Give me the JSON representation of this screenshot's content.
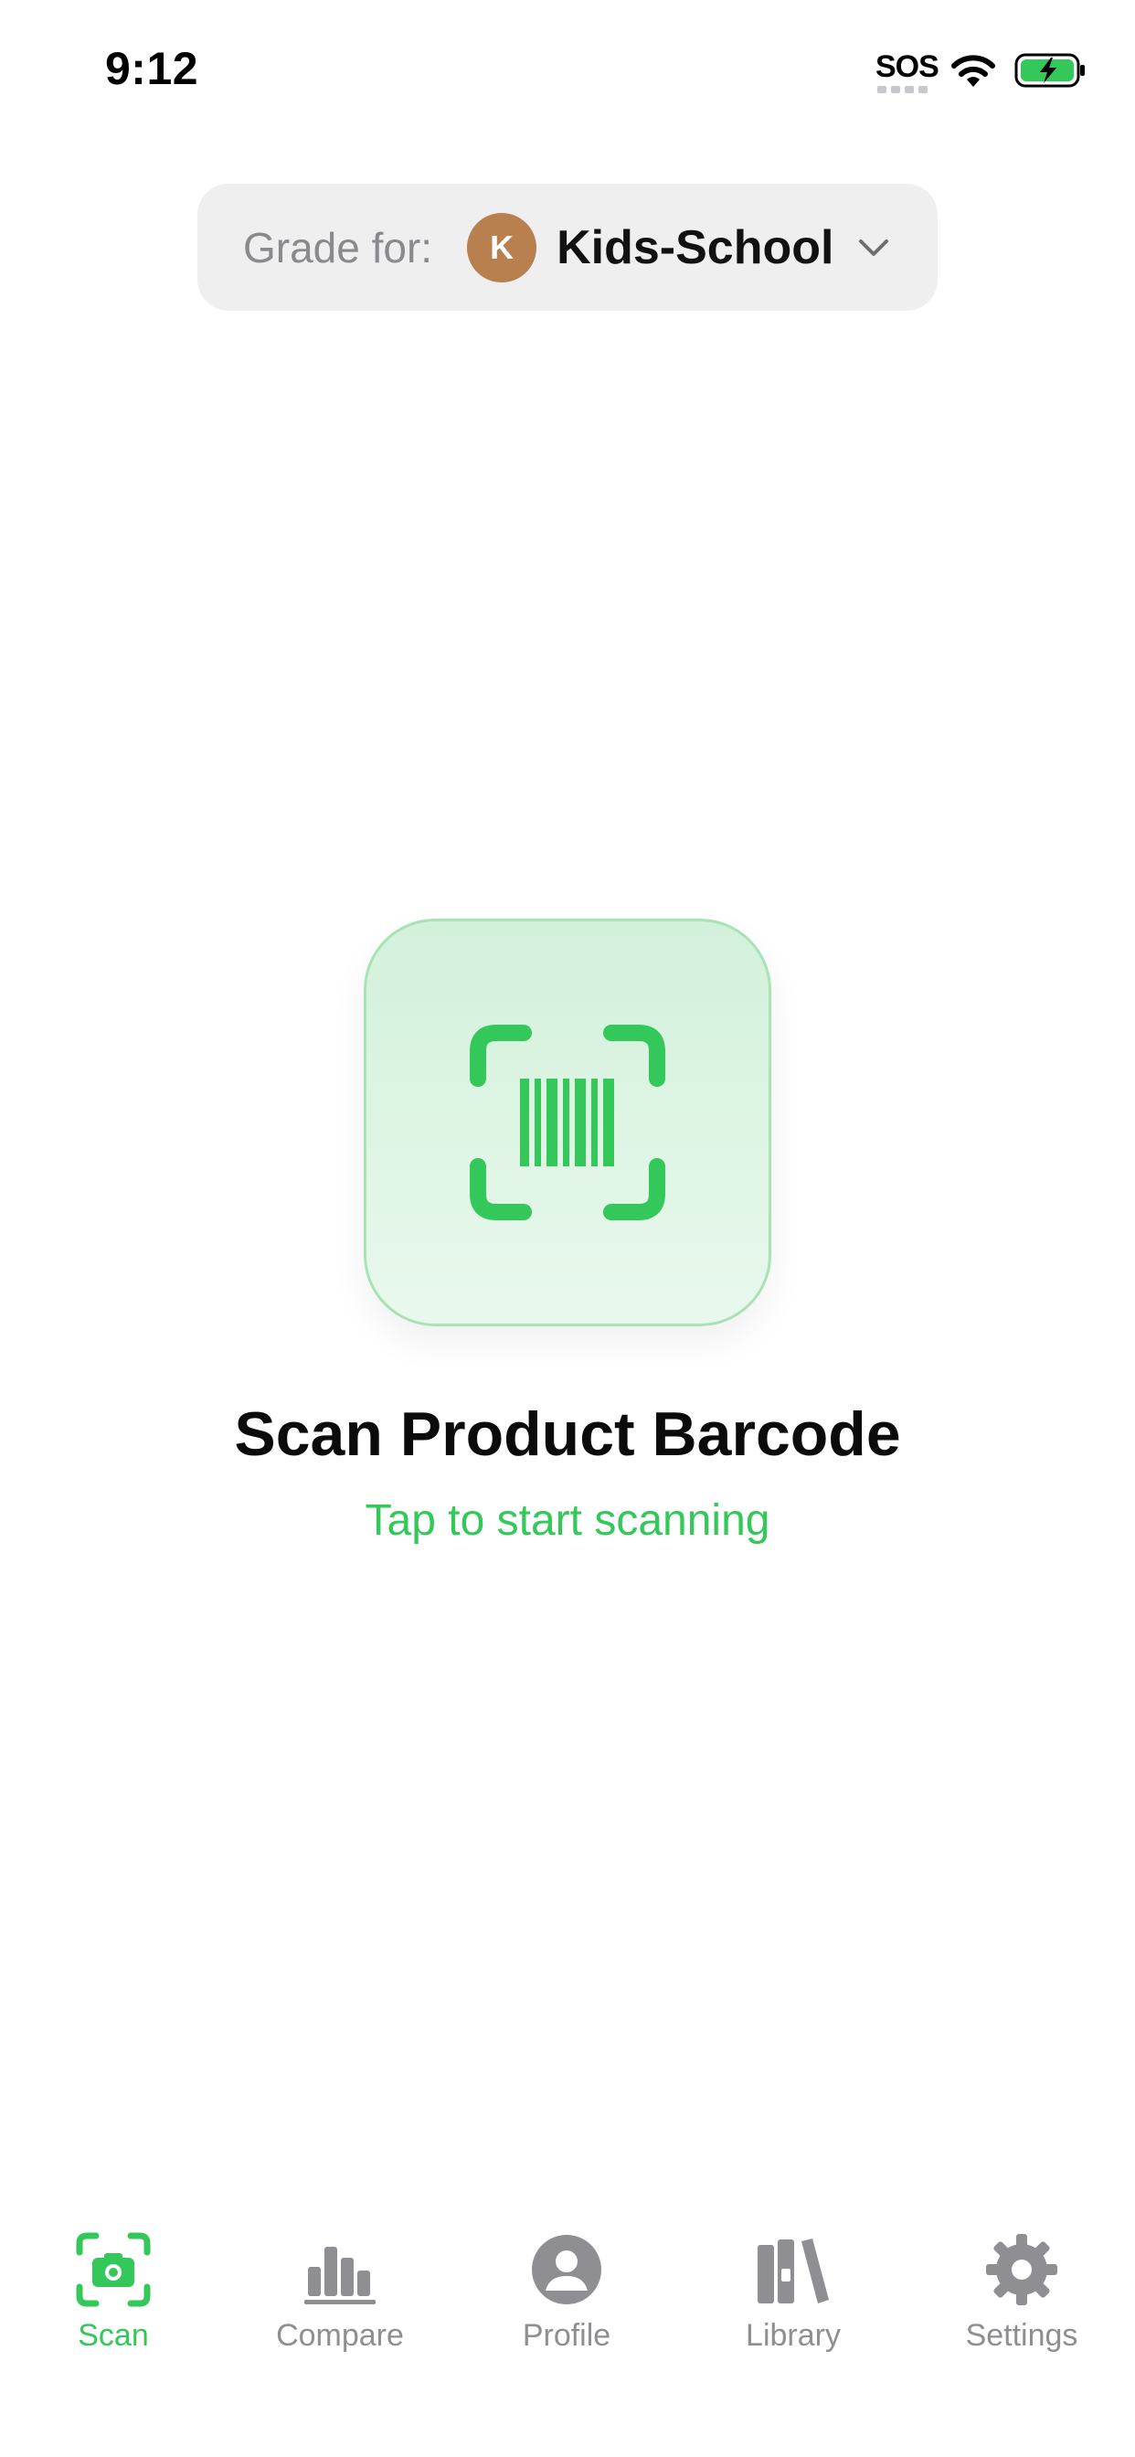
{
  "status_bar": {
    "time": "9:12",
    "sos": "SOS"
  },
  "profile_picker": {
    "label": "Grade for:",
    "avatar_initial": "K",
    "avatar_color": "#b8804e",
    "profile_name": "Kids-School"
  },
  "scan": {
    "title": "Scan Product Barcode",
    "subtitle": "Tap to start scanning",
    "icon": "barcode-viewfinder-icon"
  },
  "colors": {
    "accent": "#34c759",
    "inactive": "#8e8e93"
  },
  "tab_bar": {
    "active": "Scan",
    "items": [
      {
        "label": "Scan",
        "icon": "camera-viewfinder-icon"
      },
      {
        "label": "Compare",
        "icon": "bar-chart-icon"
      },
      {
        "label": "Profile",
        "icon": "person-circle-icon"
      },
      {
        "label": "Library",
        "icon": "books-icon"
      },
      {
        "label": "Settings",
        "icon": "gear-icon"
      }
    ]
  }
}
